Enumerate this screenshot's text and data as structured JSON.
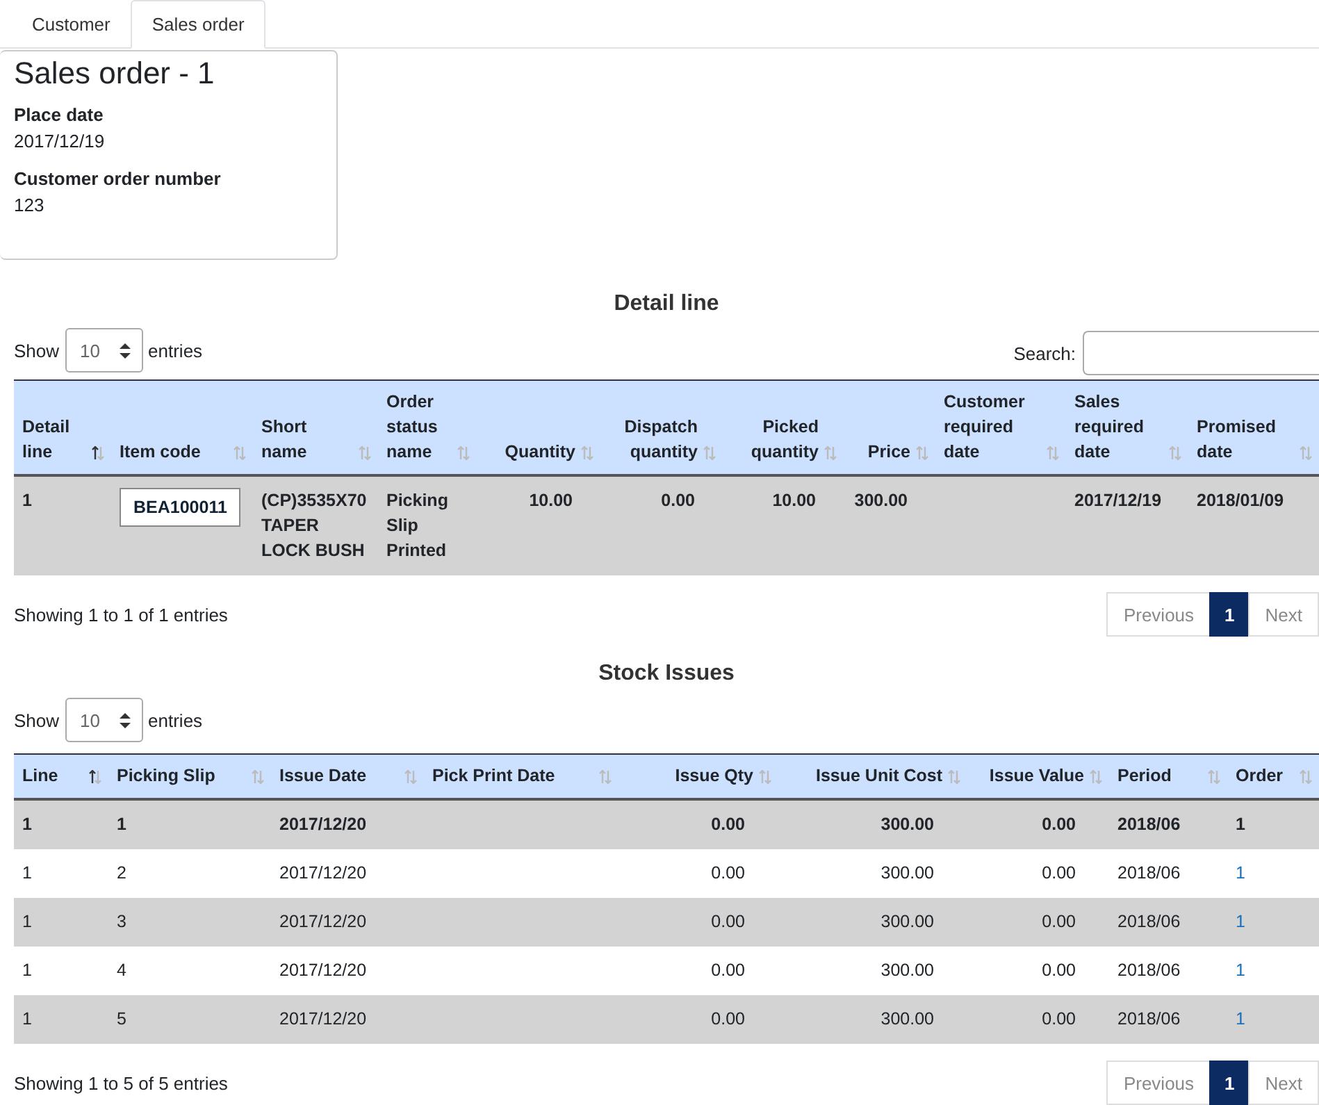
{
  "tabs": [
    {
      "label": "Customer",
      "selected": false
    },
    {
      "label": "Sales order",
      "selected": true
    }
  ],
  "card": {
    "title": "Sales order - 1",
    "fields": [
      {
        "label": "Place date",
        "value": "2017/12/19"
      },
      {
        "label": "Customer order number",
        "value": "123"
      }
    ]
  },
  "detail_table": {
    "title": "Detail line",
    "show_label": "Show",
    "page_size": "10",
    "entries_label": "entries",
    "search_label": "Search:",
    "columns": [
      {
        "label": "Detail line",
        "sorted": true,
        "kind": "text"
      },
      {
        "label": "Item code",
        "sorted": false,
        "kind": "text"
      },
      {
        "label": "Short name",
        "sorted": false,
        "kind": "text"
      },
      {
        "label": "Order status name",
        "sorted": false,
        "kind": "text"
      },
      {
        "label": "Quantity",
        "sorted": false,
        "kind": "number"
      },
      {
        "label": "Dispatch quantity",
        "sorted": false,
        "kind": "number"
      },
      {
        "label": "Picked quantity",
        "sorted": false,
        "kind": "number"
      },
      {
        "label": "Price",
        "sorted": false,
        "kind": "number"
      },
      {
        "label": "Customer required date",
        "sorted": false,
        "kind": "text"
      },
      {
        "label": "Sales required date",
        "sorted": false,
        "kind": "text"
      },
      {
        "label": "Promised date",
        "sorted": false,
        "kind": "text"
      }
    ],
    "rows": [
      {
        "selected": true,
        "cells": [
          {
            "kind": "text",
            "text": "1"
          },
          {
            "kind": "code",
            "text": "BEA100011"
          },
          {
            "kind": "text",
            "text": "(CP)3535X70 TAPER LOCK BUSH"
          },
          {
            "kind": "text",
            "text": "Picking Slip Printed"
          },
          {
            "kind": "text",
            "text": "10.00"
          },
          {
            "kind": "text",
            "text": "0.00"
          },
          {
            "kind": "text",
            "text": "10.00"
          },
          {
            "kind": "text",
            "text": "300.00"
          },
          {
            "kind": "empty"
          },
          {
            "kind": "text",
            "text": "2017/12/19"
          },
          {
            "kind": "text",
            "text": "2018/01/09"
          }
        ]
      }
    ],
    "info": "Showing 1 to 1 of 1 entries",
    "pager": [
      {
        "label": "Previous",
        "selected": false
      },
      {
        "label": "1",
        "selected": true
      },
      {
        "label": "Next",
        "selected": false
      }
    ]
  },
  "stock_table": {
    "title": "Stock Issues",
    "show_label": "Show",
    "page_size": "10",
    "entries_label": "entries",
    "columns": [
      {
        "label": "Line",
        "sorted": true,
        "kind": "text"
      },
      {
        "label": "Picking Slip",
        "sorted": false,
        "kind": "text"
      },
      {
        "label": "Issue Date",
        "sorted": false,
        "kind": "text"
      },
      {
        "label": "Pick Print Date",
        "sorted": false,
        "kind": "text"
      },
      {
        "label": "Issue Qty",
        "sorted": false,
        "kind": "number"
      },
      {
        "label": "Issue Unit Cost",
        "sorted": false,
        "kind": "number"
      },
      {
        "label": "Issue Value",
        "sorted": false,
        "kind": "number"
      },
      {
        "label": "Period",
        "sorted": false,
        "kind": "text"
      },
      {
        "label": "Order",
        "sorted": false,
        "kind": "text"
      }
    ],
    "rows": [
      {
        "selected": true,
        "cells": [
          {
            "kind": "text",
            "text": "1"
          },
          {
            "kind": "text",
            "text": "1"
          },
          {
            "kind": "text",
            "text": "2017/12/20"
          },
          {
            "kind": "empty"
          },
          {
            "kind": "text",
            "text": "0.00"
          },
          {
            "kind": "text",
            "text": "300.00"
          },
          {
            "kind": "text",
            "text": "0.00"
          },
          {
            "kind": "text",
            "text": "2018/06"
          },
          {
            "kind": "link",
            "text": "1"
          }
        ]
      },
      {
        "selected": false,
        "cells": [
          {
            "kind": "text",
            "text": "1"
          },
          {
            "kind": "text",
            "text": "2"
          },
          {
            "kind": "text",
            "text": "2017/12/20"
          },
          {
            "kind": "empty"
          },
          {
            "kind": "text",
            "text": "0.00"
          },
          {
            "kind": "text",
            "text": "300.00"
          },
          {
            "kind": "text",
            "text": "0.00"
          },
          {
            "kind": "text",
            "text": "2018/06"
          },
          {
            "kind": "link",
            "text": "1"
          }
        ]
      },
      {
        "selected": false,
        "cells": [
          {
            "kind": "text",
            "text": "1"
          },
          {
            "kind": "text",
            "text": "3"
          },
          {
            "kind": "text",
            "text": "2017/12/20"
          },
          {
            "kind": "empty"
          },
          {
            "kind": "text",
            "text": "0.00"
          },
          {
            "kind": "text",
            "text": "300.00"
          },
          {
            "kind": "text",
            "text": "0.00"
          },
          {
            "kind": "text",
            "text": "2018/06"
          },
          {
            "kind": "link",
            "text": "1"
          }
        ]
      },
      {
        "selected": false,
        "cells": [
          {
            "kind": "text",
            "text": "1"
          },
          {
            "kind": "text",
            "text": "4"
          },
          {
            "kind": "text",
            "text": "2017/12/20"
          },
          {
            "kind": "empty"
          },
          {
            "kind": "text",
            "text": "0.00"
          },
          {
            "kind": "text",
            "text": "300.00"
          },
          {
            "kind": "text",
            "text": "0.00"
          },
          {
            "kind": "text",
            "text": "2018/06"
          },
          {
            "kind": "link",
            "text": "1"
          }
        ]
      },
      {
        "selected": false,
        "cells": [
          {
            "kind": "text",
            "text": "1"
          },
          {
            "kind": "text",
            "text": "5"
          },
          {
            "kind": "text",
            "text": "2017/12/20"
          },
          {
            "kind": "empty"
          },
          {
            "kind": "text",
            "text": "0.00"
          },
          {
            "kind": "text",
            "text": "300.00"
          },
          {
            "kind": "text",
            "text": "0.00"
          },
          {
            "kind": "text",
            "text": "2018/06"
          },
          {
            "kind": "link",
            "text": "1"
          }
        ]
      }
    ],
    "info": "Showing 1 to 5 of 5 entries",
    "pager": [
      {
        "label": "Previous",
        "selected": false
      },
      {
        "label": "1",
        "selected": true
      },
      {
        "label": "Next",
        "selected": false
      }
    ]
  }
}
